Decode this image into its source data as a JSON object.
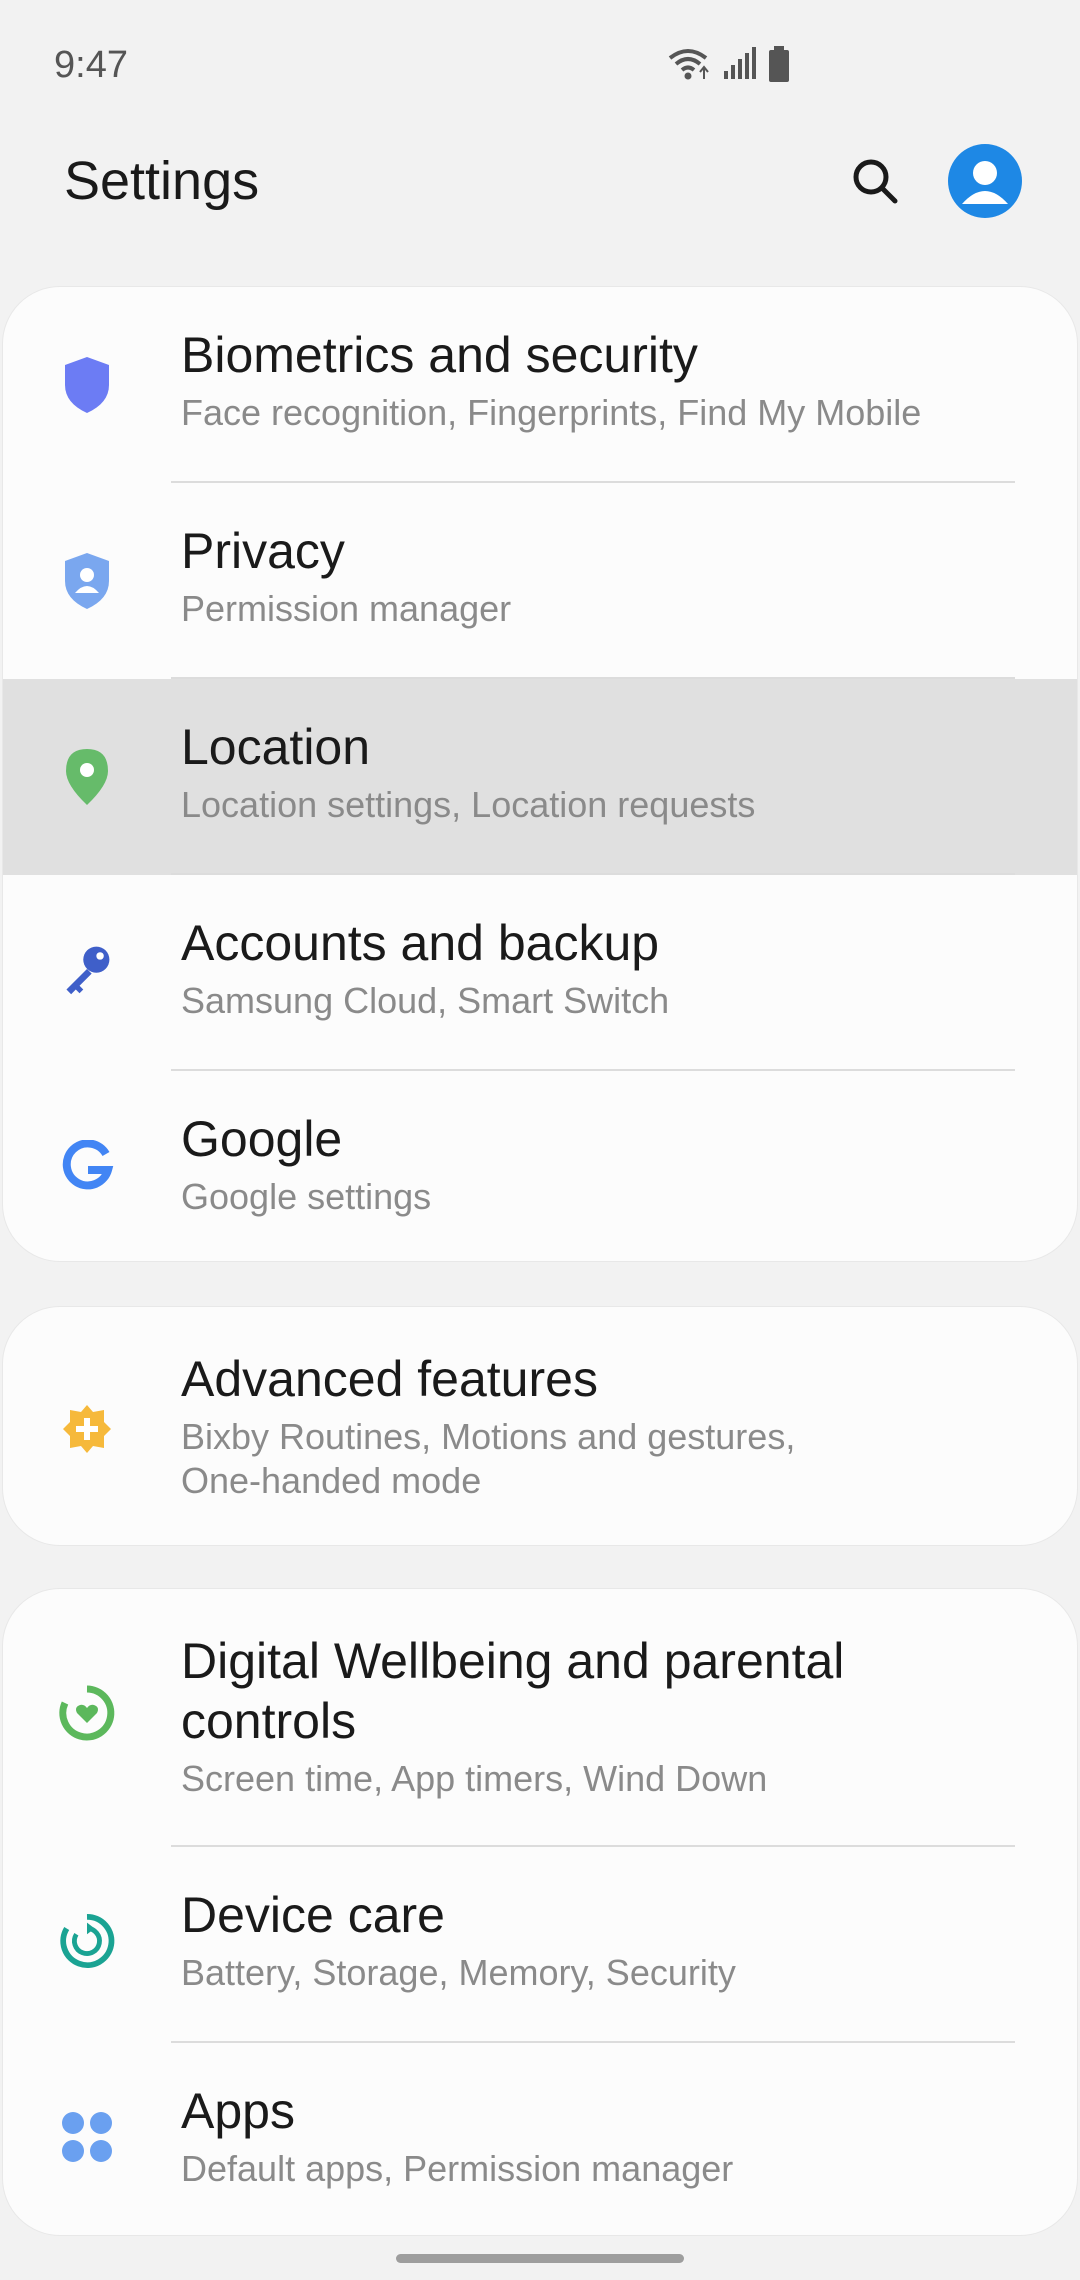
{
  "status_bar": {
    "time": "9:47"
  },
  "header": {
    "title": "Settings"
  },
  "groups": [
    {
      "items": [
        {
          "title": "Biometrics and security",
          "subtitle": "Face recognition, Fingerprints, Find My Mobile",
          "icon": "shield-icon",
          "icon_color": "#6c7cf4"
        },
        {
          "title": "Privacy",
          "subtitle": "Permission manager",
          "icon": "privacy-shield-icon",
          "icon_color": "#7aa7ef"
        },
        {
          "title": "Location",
          "subtitle": "Location settings, Location requests",
          "icon": "location-pin-icon",
          "icon_color": "#66bb6a",
          "highlighted": true
        },
        {
          "title": "Accounts and backup",
          "subtitle": "Samsung Cloud, Smart Switch",
          "icon": "key-icon",
          "icon_color": "#3f5fc9"
        },
        {
          "title": "Google",
          "subtitle": "Google settings",
          "icon": "google-icon",
          "icon_color": "#4285f4"
        }
      ]
    },
    {
      "items": [
        {
          "title": "Advanced features",
          "subtitle": "Bixby Routines, Motions and gestures, One-handed mode",
          "icon": "puzzle-plus-icon",
          "icon_color": "#f6b93b"
        }
      ]
    },
    {
      "items": [
        {
          "title": "Digital Wellbeing and parental controls",
          "subtitle": "Screen time, App timers, Wind Down",
          "icon": "wellbeing-icon",
          "icon_color": "#5cb85c"
        },
        {
          "title": "Device care",
          "subtitle": "Battery, Storage, Memory, Security",
          "icon": "device-care-icon",
          "icon_color": "#1aa393"
        },
        {
          "title": "Apps",
          "subtitle": "Default apps, Permission manager",
          "icon": "apps-grid-icon",
          "icon_color": "#6aa0f0"
        }
      ]
    }
  ]
}
